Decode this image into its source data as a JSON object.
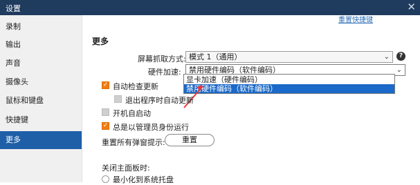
{
  "window": {
    "title": "设置",
    "close_glyph": "✕"
  },
  "sidebar": {
    "items": [
      {
        "label": "录制"
      },
      {
        "label": "输出"
      },
      {
        "label": "声音"
      },
      {
        "label": "摄像头"
      },
      {
        "label": "鼠标和键盘"
      },
      {
        "label": "快捷键"
      },
      {
        "label": "更多",
        "active": true
      }
    ]
  },
  "top_link": "重置快捷键",
  "section": {
    "title": "更多"
  },
  "capture": {
    "label": "屏幕抓取方式:",
    "value": "模式 1（通用）",
    "help": "?"
  },
  "hardware": {
    "label": "硬件加速:",
    "value": "禁用硬件编码（软件编码）",
    "options": [
      "显卡加速（硬件编码）",
      "禁用硬件编码（软件编码）"
    ],
    "selected_index": 1
  },
  "checkboxes": {
    "auto_update": {
      "label": "自动检查更新",
      "checked": true
    },
    "exit_update": {
      "label": "退出程序时自动更新",
      "checked": false
    },
    "autostart": {
      "label": "开机自启动",
      "checked": false
    },
    "run_admin": {
      "label": "总是以管理员身份运行",
      "checked": true
    }
  },
  "reset_popups": {
    "label": "重置所有弹窗提示:",
    "button": "重置"
  },
  "close_panel": {
    "label": "关闭主面板时:",
    "option_minimize": "最小化到系统托盘"
  },
  "colors": {
    "titlebar": "#1f3b5e",
    "accent": "#1f5fa8",
    "checkbox": "#f07d14",
    "arrow": "#e8383d"
  }
}
